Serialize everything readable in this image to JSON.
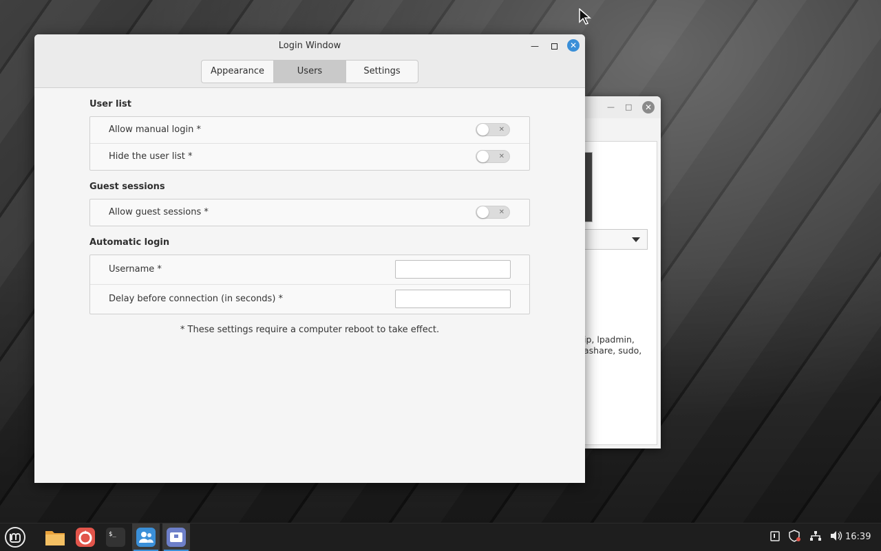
{
  "window": {
    "title": "Login Window",
    "tabs": [
      {
        "label": "Appearance",
        "active": false
      },
      {
        "label": "Users",
        "active": true
      },
      {
        "label": "Settings",
        "active": false
      }
    ],
    "controls": {
      "minimize": "minimize-icon",
      "maximize": "maximize-icon",
      "close": "close-icon"
    }
  },
  "sections": {
    "user_list": {
      "title": "User list",
      "rows": [
        {
          "label": "Allow manual login *",
          "enabled": false
        },
        {
          "label": "Hide the user list *",
          "enabled": false
        }
      ]
    },
    "guest_sessions": {
      "title": "Guest sessions",
      "rows": [
        {
          "label": "Allow guest sessions *",
          "enabled": false
        }
      ]
    },
    "automatic_login": {
      "title": "Automatic login",
      "rows": [
        {
          "label": "Username *",
          "value": ""
        },
        {
          "label": "Delay before connection (in seconds) *",
          "value": ""
        }
      ]
    }
  },
  "footnote": "* These settings require a computer reboot to take effect.",
  "background_window": {
    "visible_text": "ip, lpadmin,\nashare, sudo,"
  },
  "taskbar": {
    "apps": [
      "mint-menu-icon",
      "files-icon",
      "firefox-icon",
      "terminal-icon",
      "users-groups-icon",
      "login-window-icon"
    ],
    "tray": [
      "clipboard-icon",
      "update-shield-icon",
      "network-icon",
      "volume-icon"
    ],
    "clock": "16:39"
  },
  "colors": {
    "accent": "#3a8fd8",
    "taskbar": "#1e1e1e",
    "window_bg": "#f5f5f5"
  }
}
